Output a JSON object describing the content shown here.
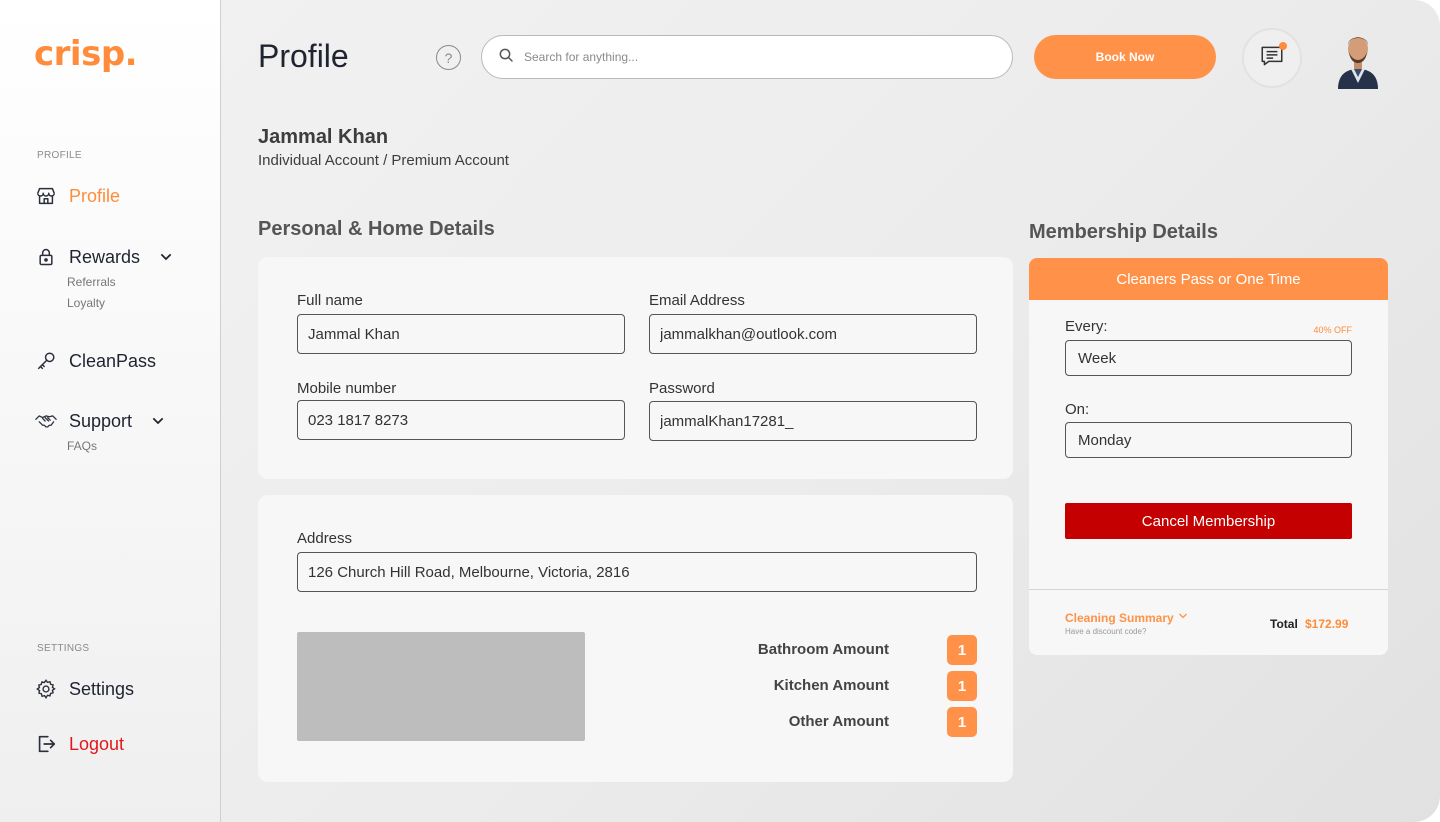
{
  "brand": {
    "logo_text": "crisp.",
    "accent": "#ff8c3a"
  },
  "sidebar": {
    "profile_section": "PROFILE",
    "settings_section": "SETTINGS",
    "items": [
      {
        "label": "Profile",
        "icon": "store-icon"
      },
      {
        "label": "Rewards",
        "icon": "lock-icon",
        "sub": [
          "Referrals",
          "Loyalty"
        ]
      },
      {
        "label": "CleanPass",
        "icon": "key-icon"
      },
      {
        "label": "Support",
        "icon": "handshake-icon",
        "sub": [
          "FAQs"
        ]
      },
      {
        "label": "Settings",
        "icon": "gear-icon"
      },
      {
        "label": "Logout",
        "icon": "logout-icon"
      }
    ]
  },
  "header": {
    "title": "Profile",
    "help": "?",
    "search_placeholder": "Search for anything...",
    "book_label": "Book Now"
  },
  "user": {
    "name": "Jammal Khan",
    "account_type": "Individual Account / Premium Account"
  },
  "personal": {
    "title": "Personal & Home Details",
    "full_name_label": "Full name",
    "full_name": "Jammal Khan",
    "email_label": "Email Address",
    "email": "jammalkhan@outlook.com",
    "mobile_label": "Mobile number",
    "mobile": "023 1817 8273",
    "password_label": "Password",
    "password": "jammalKhan17281_",
    "address_label": "Address",
    "address": "126 Church Hill Road, Melbourne, Victoria, 2816",
    "amounts": [
      {
        "label": "Bathroom Amount",
        "value": "1"
      },
      {
        "label": "Kitchen Amount",
        "value": "1"
      },
      {
        "label": "Other Amount",
        "value": "1"
      }
    ]
  },
  "membership": {
    "title": "Membership Details",
    "plan": "Cleaners Pass or One Time",
    "every_label": "Every:",
    "discount": "40% OFF",
    "every_value": "Week",
    "on_label": "On:",
    "on_value": "Monday",
    "cancel_label": "Cancel Membership",
    "summary_label": "Cleaning Summary",
    "discount_prompt": "Have a discount code?",
    "total_label": "Total",
    "total_value": "$172.99"
  }
}
